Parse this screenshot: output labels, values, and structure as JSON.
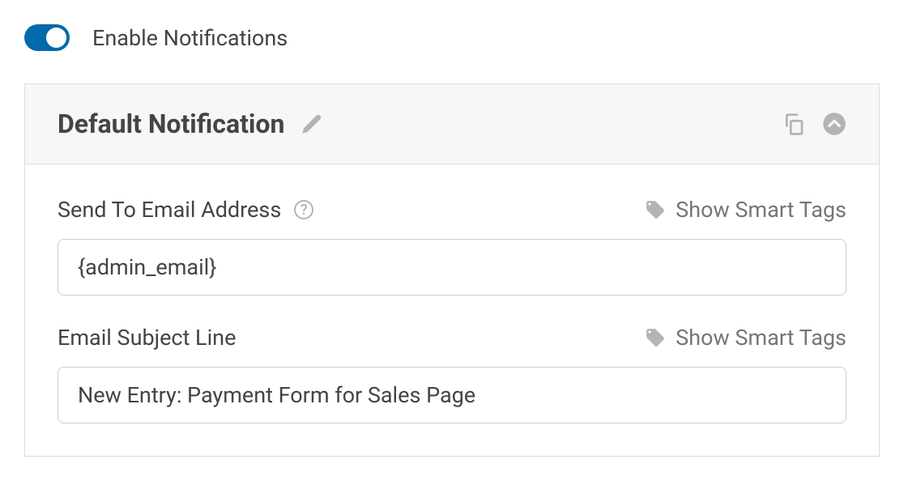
{
  "toggle": {
    "label": "Enable Notifications",
    "enabled": true
  },
  "panel": {
    "title": "Default Notification"
  },
  "fields": {
    "send_to": {
      "label": "Send To Email Address",
      "value": "{admin_email}",
      "smart_tags_label": "Show Smart Tags"
    },
    "subject": {
      "label": "Email Subject Line",
      "value": "New Entry: Payment Form for Sales Page",
      "smart_tags_label": "Show Smart Tags"
    }
  }
}
